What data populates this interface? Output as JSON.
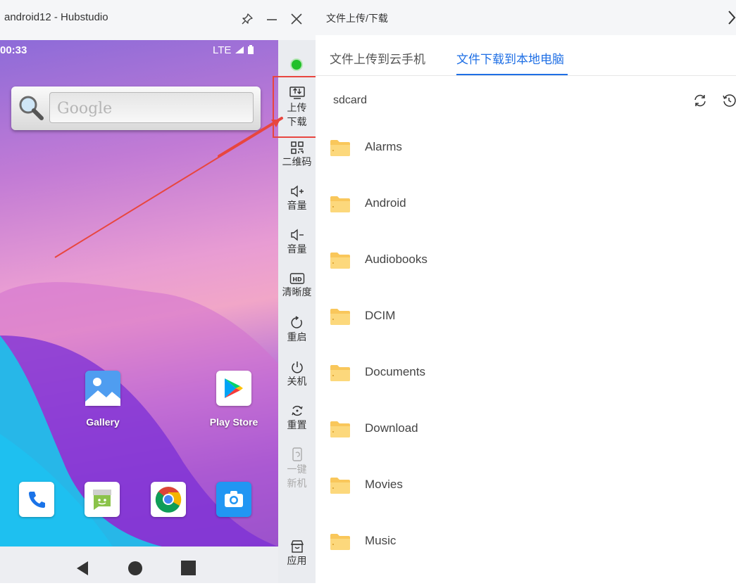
{
  "window": {
    "title": "android12 - Hubstudio"
  },
  "phone": {
    "status_time": "00:33",
    "status_network": "LTE",
    "search_placeholder": "Google",
    "apps": [
      {
        "label": "Gallery",
        "icon": "gallery-icon"
      },
      {
        "label": "Play Store",
        "icon": "play-store-icon"
      }
    ],
    "dock": [
      {
        "icon": "phone-icon"
      },
      {
        "icon": "messages-icon"
      },
      {
        "icon": "chrome-icon"
      },
      {
        "icon": "camera-icon"
      }
    ]
  },
  "toolbar": {
    "status_color": "#22c02a",
    "items": [
      {
        "label_line1": "上传",
        "label_line2": "下载",
        "icon": "upload-download-icon"
      },
      {
        "label_line1": "二维码",
        "icon": "qrcode-icon"
      },
      {
        "label_line1": "音量",
        "icon": "volume-up-icon"
      },
      {
        "label_line1": "音量",
        "icon": "volume-down-icon"
      },
      {
        "label_line1": "清晰度",
        "icon": "hd-icon"
      },
      {
        "label_line1": "重启",
        "icon": "restart-icon"
      },
      {
        "label_line1": "关机",
        "icon": "power-icon"
      },
      {
        "label_line1": "重置",
        "icon": "reset-icon"
      },
      {
        "label_line1": "一键",
        "label_line2": "新机",
        "icon": "new-device-icon"
      },
      {
        "label_line1": "应用",
        "icon": "apps-store-icon"
      }
    ]
  },
  "panel": {
    "title": "文件上传/下载",
    "tabs": [
      {
        "label": "文件上传到云手机",
        "active": false
      },
      {
        "label": "文件下载到本地电脑",
        "active": true
      }
    ],
    "accent_color": "#1f6fe5",
    "path": "sdcard",
    "folders": [
      "Alarms",
      "Android",
      "Audiobooks",
      "DCIM",
      "Documents",
      "Download",
      "Movies",
      "Music"
    ]
  }
}
